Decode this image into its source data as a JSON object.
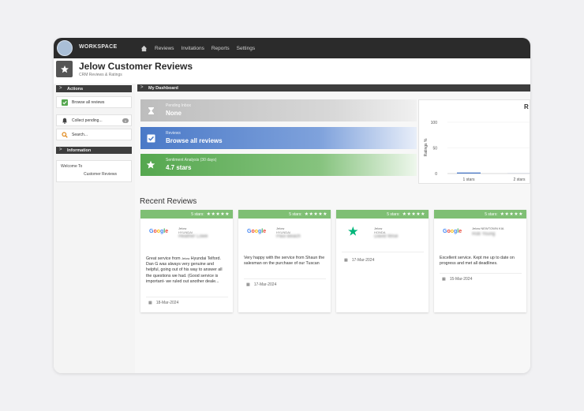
{
  "app": {
    "brand": "WORKSPACE",
    "nav": [
      "Reviews",
      "Invitations",
      "Reports",
      "Settings"
    ]
  },
  "page": {
    "title": "Jelow Customer Reviews",
    "subtitle": "CRM Reviews & Ratings"
  },
  "sidebar": {
    "actions_header": "Actions",
    "items": [
      {
        "label": "Browse all reviews"
      },
      {
        "label": "Collect pending...",
        "badge": "0"
      },
      {
        "label": "Search..."
      }
    ],
    "info_header": "Information",
    "info_welcome": "Welcome To",
    "info_name": "Customer Reviews"
  },
  "dashboard": {
    "header": "My Dashboard",
    "tiles": [
      {
        "small": "Pending Inbox",
        "big": "None"
      },
      {
        "small": "Reviews",
        "big": "Browse all reviews"
      },
      {
        "small": "Sentiment Analysis (30 days)",
        "big": "4.7 stars"
      }
    ],
    "recent_title": "Recent Reviews"
  },
  "chart_data": {
    "type": "bar",
    "title": "R",
    "ylabel": "Ratings %",
    "categories": [
      "1 stars",
      "2 stars"
    ],
    "values": [
      2,
      0
    ],
    "yticks": [
      0,
      50,
      100
    ],
    "ylim": [
      0,
      100
    ]
  },
  "reviews": [
    {
      "rating": "5 stars:",
      "stars": "★★★★★",
      "logo": "Google",
      "brand": "Jelow",
      "dealer": "HYUNDAI",
      "name": "Heather Lowe",
      "text_a": "Great service from",
      "text_brand": "Jelow",
      "text_b": "Hyundai Telford. Dan G was always very genuine and helpful, going out of his way to answer all the questions we had. (Good service is important- we ruled out another deale...",
      "date": "18-Mar-2024"
    },
    {
      "rating": "5 stars:",
      "stars": "★★★★★",
      "logo": "Google",
      "brand": "Jelow",
      "dealer": "HYUNDAI",
      "name": "Paul Beach",
      "text_a": "Very happy with the service from Shaun the salesman on the purchase of our Tuscan",
      "text_brand": "",
      "text_b": "",
      "date": "17-Mar-2024"
    },
    {
      "rating": "5 stars:",
      "stars": "★★★★★",
      "logo": "★",
      "brand": "Jelow",
      "dealer": "HONDA",
      "name": "David Wise",
      "text_a": "",
      "text_brand": "",
      "text_b": "",
      "date": "17-Mar-2024"
    },
    {
      "rating": "5 stars:",
      "stars": "★★★★★",
      "logo": "Google",
      "brand": "Jelow",
      "dealer": "NEWTOWN KIA",
      "name": "Rob Young",
      "text_a": "Excellent service. Kept me up to date on progress and met all deadlines.",
      "text_brand": "",
      "text_b": "",
      "date": "15-Mar-2024"
    }
  ],
  "colors": {
    "dark": "#2b2b2b",
    "blue": "#4a79c7",
    "green": "#55a74f",
    "card_head": "#7fbf74"
  }
}
